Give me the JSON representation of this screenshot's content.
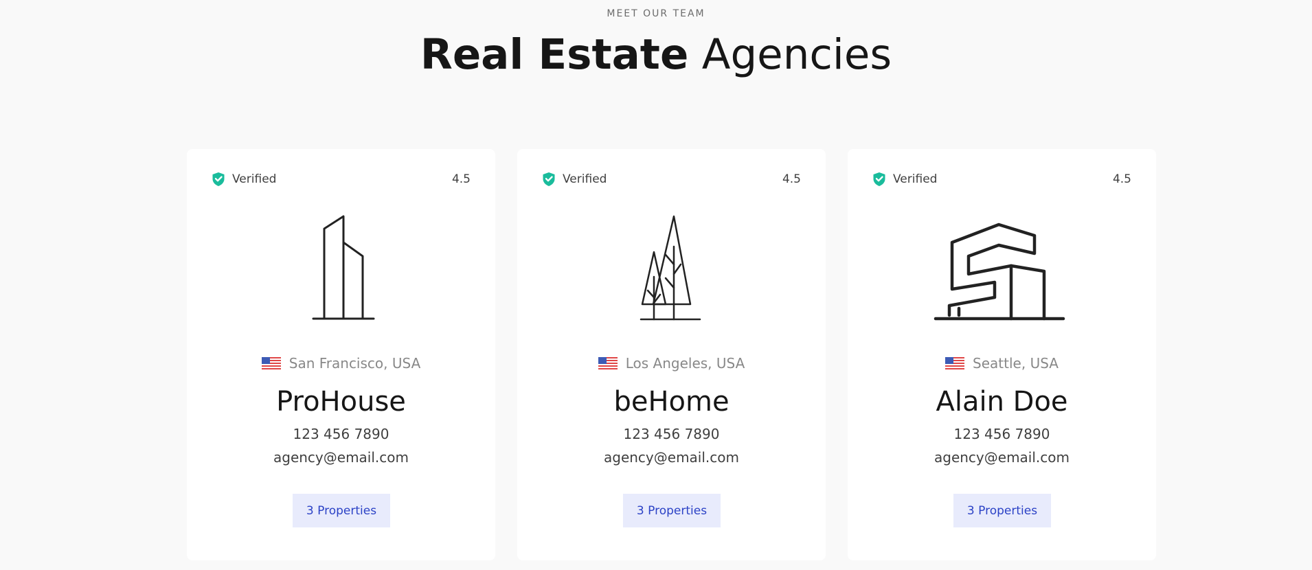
{
  "header": {
    "eyebrow": "MEET OUR TEAM",
    "title_strong": "Real Estate",
    "title_light": "Agencies"
  },
  "colors": {
    "verified_green": "#1abc9c",
    "button_bg": "#e8ebfc",
    "button_text": "#2b42c6",
    "page_bg": "#f9f9f9",
    "card_bg": "#ffffff"
  },
  "cards": [
    {
      "verified_label": "Verified",
      "rating": "4.5",
      "logo_icon": "skyscraper-logo-icon",
      "flag_icon": "us-flag-icon",
      "location": "San Francisco, USA",
      "name": "ProHouse",
      "phone": "123 456 7890",
      "email": "agency@email.com",
      "properties_label": "3 Properties"
    },
    {
      "verified_label": "Verified",
      "rating": "4.5",
      "logo_icon": "trees-logo-icon",
      "flag_icon": "us-flag-icon",
      "location": "Los Angeles, USA",
      "name": "beHome",
      "phone": "123 456 7890",
      "email": "agency@email.com",
      "properties_label": "3 Properties"
    },
    {
      "verified_label": "Verified",
      "rating": "4.5",
      "logo_icon": "modern-house-logo-icon",
      "flag_icon": "us-flag-icon",
      "location": "Seattle, USA",
      "name": "Alain Doe",
      "phone": "123 456 7890",
      "email": "agency@email.com",
      "properties_label": "3 Properties"
    }
  ]
}
